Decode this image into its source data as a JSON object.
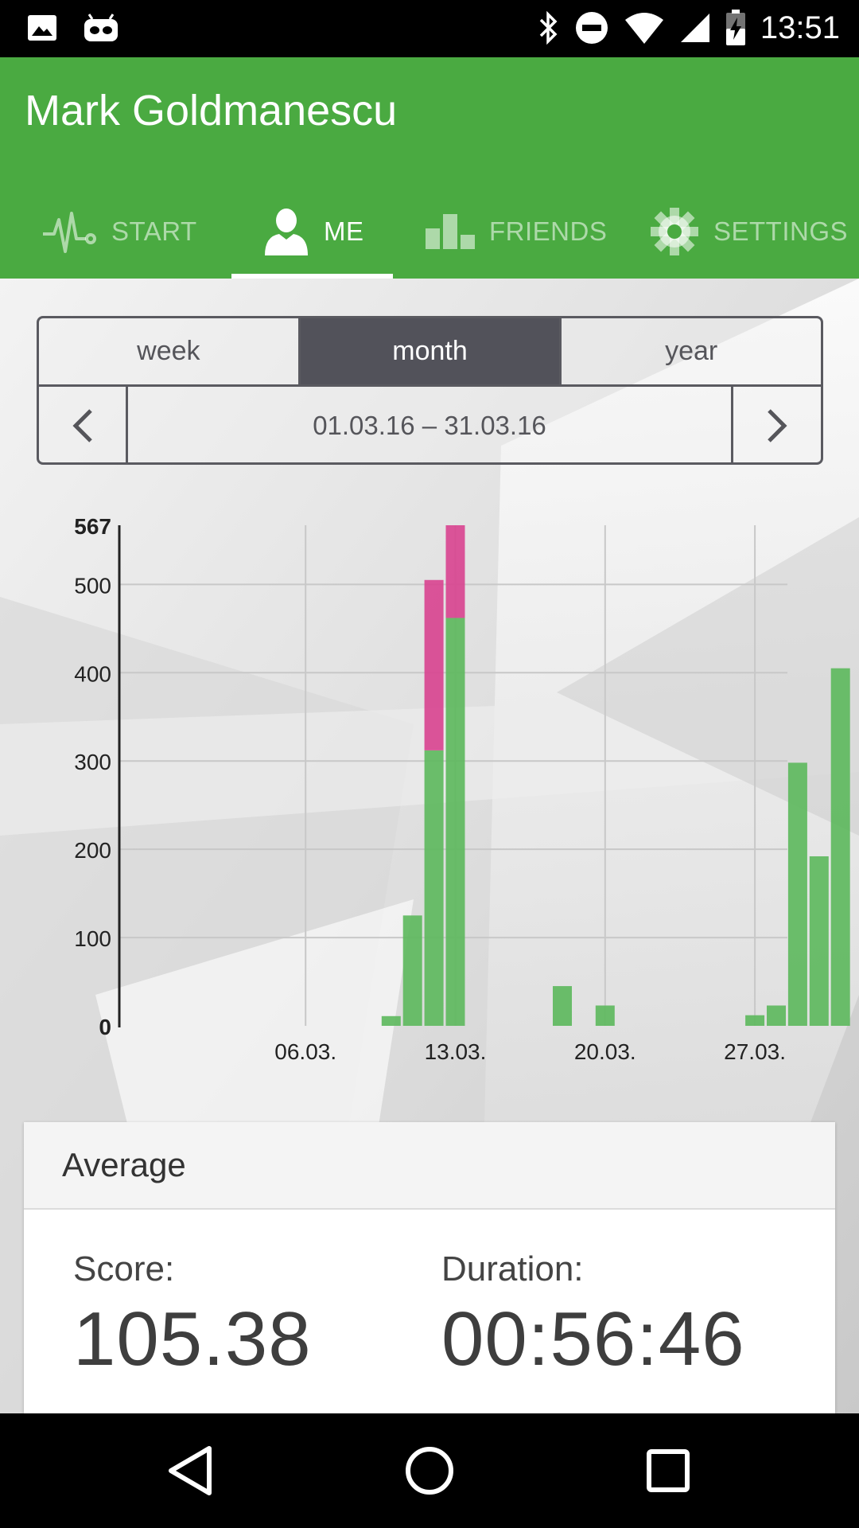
{
  "status_bar": {
    "time": "13:51",
    "left_icons": [
      "image-icon",
      "android-debug-icon"
    ],
    "right_icons": [
      "bluetooth-icon",
      "do-not-disturb-icon",
      "wifi-icon",
      "signal-icon",
      "battery-charging-icon"
    ]
  },
  "app_bar": {
    "title": "Mark Goldmanescu",
    "background": "#4aaa41",
    "tabs": [
      {
        "label": "START",
        "icon": "pulse-icon",
        "active": false
      },
      {
        "label": "ME",
        "icon": "person-icon",
        "active": true
      },
      {
        "label": "FRIENDS",
        "icon": "bar-chart-icon",
        "active": false
      },
      {
        "label": "SETTINGS",
        "icon": "gear-icon",
        "active": false
      }
    ]
  },
  "period": {
    "options": [
      "week",
      "month",
      "year"
    ],
    "selected": "month",
    "range": "01.03.16 – 31.03.16"
  },
  "chart_data": {
    "type": "bar",
    "stacked": true,
    "y_max_label": "567",
    "y_ticks": [
      "0",
      "100",
      "200",
      "300",
      "400",
      "500"
    ],
    "ylim": [
      0,
      567
    ],
    "x_tick_labels": [
      {
        "day": 6,
        "label": "06.03."
      },
      {
        "day": 13,
        "label": "13.03."
      },
      {
        "day": 20,
        "label": "20.03."
      },
      {
        "day": 27,
        "label": "27.03."
      }
    ],
    "x_range_days": [
      1,
      31
    ],
    "grid": true,
    "series": [
      {
        "color": "#5cb85c",
        "points": [
          {
            "day": 10,
            "value": 11
          },
          {
            "day": 11,
            "value": 125
          },
          {
            "day": 12,
            "value": 312
          },
          {
            "day": 13,
            "value": 462
          },
          {
            "day": 18,
            "value": 45
          },
          {
            "day": 20,
            "value": 23
          },
          {
            "day": 27,
            "value": 12
          },
          {
            "day": 28,
            "value": 23
          },
          {
            "day": 29,
            "value": 298
          },
          {
            "day": 30,
            "value": 192
          },
          {
            "day": 31,
            "value": 405
          }
        ]
      },
      {
        "color": "#d8438f",
        "points": [
          {
            "day": 12,
            "value": 193
          },
          {
            "day": 13,
            "value": 105
          }
        ]
      }
    ]
  },
  "average": {
    "heading": "Average",
    "score_label": "Score:",
    "score_value": "105.38",
    "duration_label": "Duration:",
    "duration_value": "00:56:46"
  },
  "nav_bar": {
    "buttons": [
      "back-icon",
      "home-icon",
      "recents-icon"
    ]
  }
}
